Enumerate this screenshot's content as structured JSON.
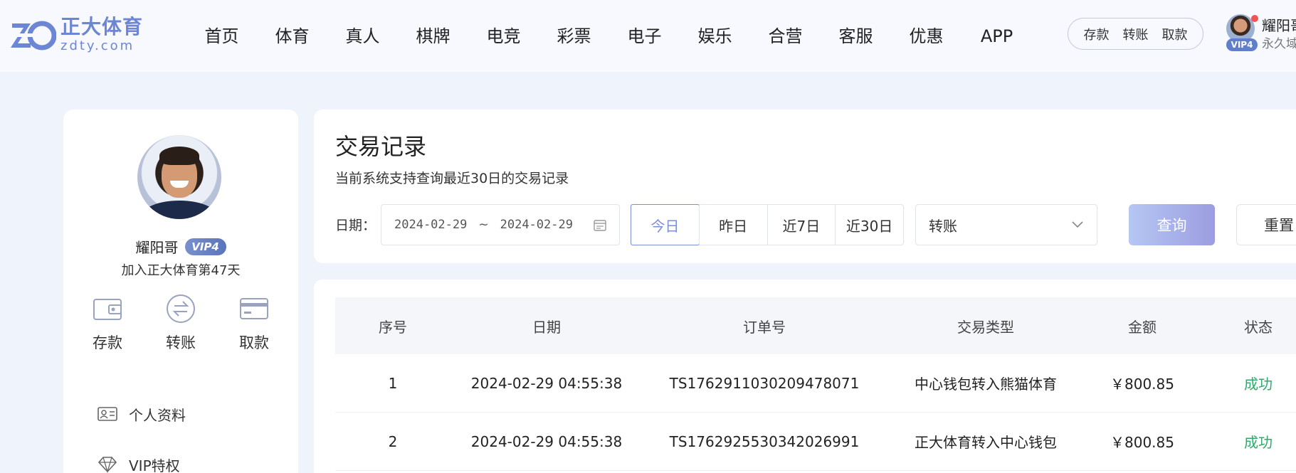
{
  "brand": {
    "name_cn": "正大体育",
    "domain": "zdty.com",
    "mark": "ZD",
    "color": "#6d86d4"
  },
  "nav": [
    "首页",
    "体育",
    "真人",
    "棋牌",
    "电竞",
    "彩票",
    "电子",
    "娱乐",
    "合营",
    "客服",
    "优惠",
    "APP"
  ],
  "quick_actions": [
    "存款",
    "转账",
    "取款"
  ],
  "header_user": {
    "name": "耀阳哥",
    "vip": "VIP4",
    "subtitle": "永久域"
  },
  "profile": {
    "name": "耀阳哥",
    "vip": "VIP4",
    "join_text": "加入正大体育第47天",
    "actions": [
      {
        "label": "存款",
        "icon": "wallet-icon"
      },
      {
        "label": "转账",
        "icon": "transfer-icon"
      },
      {
        "label": "取款",
        "icon": "card-icon"
      }
    ],
    "menu": [
      {
        "label": "个人资料",
        "icon": "id-card-icon"
      },
      {
        "label": "VIP特权",
        "icon": "diamond-icon"
      }
    ]
  },
  "filter": {
    "title": "交易记录",
    "subtitle": "当前系统支持查询最近30日的交易记录",
    "date_label": "日期：",
    "date_start": "2024-02-29",
    "date_sep": "~",
    "date_end": "2024-02-29",
    "ranges": [
      "今日",
      "昨日",
      "近7日",
      "近30日"
    ],
    "active_range": "今日",
    "type_value": "转账",
    "query_label": "查询",
    "reset_label": "重置"
  },
  "table": {
    "headers": [
      "序号",
      "日期",
      "订单号",
      "交易类型",
      "金额",
      "状态"
    ],
    "rows": [
      {
        "idx": "1",
        "date": "2024-02-29 04:55:38",
        "order": "TS176291103020947807​1",
        "type": "中心钱包转入熊猫体育",
        "amount": "￥800.85",
        "status": "成功"
      },
      {
        "idx": "2",
        "date": "2024-02-29 04:55:38",
        "order": "TS1762925530342026991",
        "type": "正大体育转入中心钱包",
        "amount": "￥800.85",
        "status": "成功"
      }
    ],
    "status_color": "#2eaa6b"
  }
}
